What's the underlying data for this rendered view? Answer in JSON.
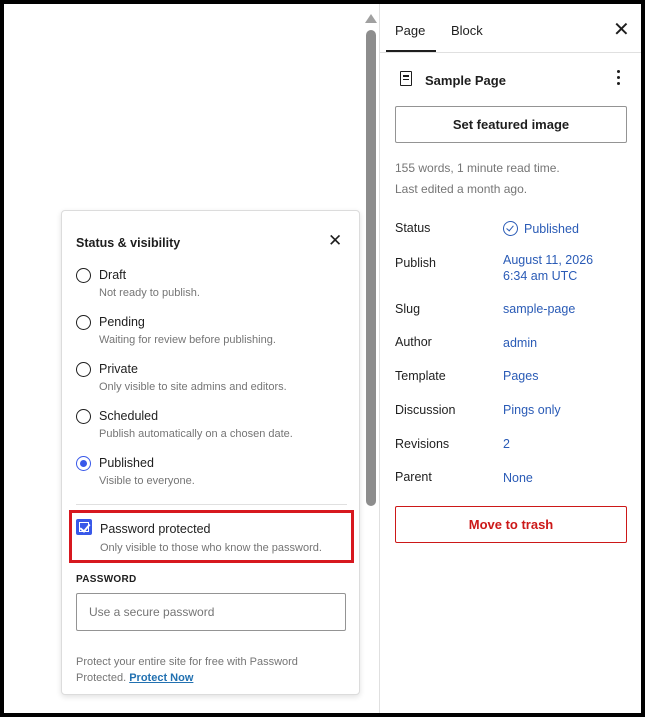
{
  "sidebar": {
    "tabs": [
      {
        "label": "Page",
        "active": true
      },
      {
        "label": "Block",
        "active": false
      }
    ],
    "close_icon": "close-icon",
    "document": {
      "icon": "page-icon",
      "title": "Sample Page",
      "menu_icon": "more-vertical-icon"
    },
    "featured_image_button": "Set featured image",
    "stats": {
      "words": "155 words, 1 minute read time.",
      "last_edited": "Last edited a month ago."
    },
    "rows": [
      {
        "label": "Status",
        "value": "Published",
        "icon": "check-circle-icon"
      },
      {
        "label": "Publish",
        "value_line1": "August 11, 2026",
        "value_line2": "6:34 am UTC"
      },
      {
        "label": "Slug",
        "value": "sample-page"
      },
      {
        "label": "Author",
        "value": "admin"
      },
      {
        "label": "Template",
        "value": "Pages"
      },
      {
        "label": "Discussion",
        "value": "Pings only"
      },
      {
        "label": "Revisions",
        "value": "2"
      },
      {
        "label": "Parent",
        "value": "None"
      }
    ],
    "trash_button": "Move to trash"
  },
  "popover": {
    "title": "Status & visibility",
    "close_icon": "close-icon",
    "options": [
      {
        "label": "Draft",
        "description": "Not ready to publish.",
        "checked": false
      },
      {
        "label": "Pending",
        "description": "Waiting for review before publishing.",
        "checked": false
      },
      {
        "label": "Private",
        "description": "Only visible to site admins and editors.",
        "checked": false
      },
      {
        "label": "Scheduled",
        "description": "Publish automatically on a chosen date.",
        "checked": false
      },
      {
        "label": "Published",
        "description": "Visible to everyone.",
        "checked": true
      }
    ],
    "password_protected": {
      "label": "Password protected",
      "description": "Only visible to those who know the password.",
      "checked": true
    },
    "password": {
      "label": "PASSWORD",
      "value": "",
      "placeholder": "Use a secure password"
    },
    "promo": {
      "text": "Protect your entire site for free with Password Protected.",
      "link": "Protect Now"
    }
  },
  "colors": {
    "accent": "#3858e9",
    "link": "#2a5bb6",
    "danger": "#cc1818",
    "highlight": "#d7181f"
  }
}
